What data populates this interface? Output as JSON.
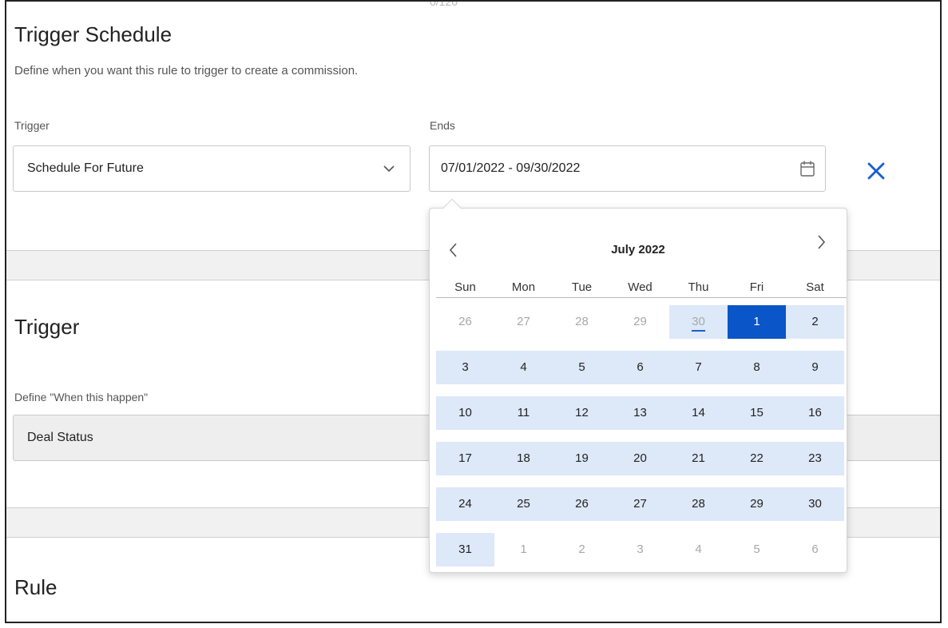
{
  "counter_text": "0/120",
  "trigger_schedule": {
    "title": "Trigger Schedule",
    "description": "Define when you want this rule to trigger to create a commission.",
    "trigger_label": "Trigger",
    "trigger_value": "Schedule For Future",
    "ends_label": "Ends",
    "ends_value": "07/01/2022 - 09/30/2022"
  },
  "trigger_section": {
    "title": "Trigger",
    "define_label": "Define \"When this happen\"",
    "define_value": "Deal Status"
  },
  "rule_section": {
    "title": "Rule"
  },
  "calendar": {
    "month_label": "July 2022",
    "weekdays": [
      "Sun",
      "Mon",
      "Tue",
      "Wed",
      "Thu",
      "Fri",
      "Sat"
    ],
    "weeks": [
      [
        {
          "d": "26",
          "s": "muted"
        },
        {
          "d": "27",
          "s": "muted"
        },
        {
          "d": "28",
          "s": "muted"
        },
        {
          "d": "29",
          "s": "muted"
        },
        {
          "d": "30",
          "s": "muted-range-today"
        },
        {
          "d": "1",
          "s": "selected"
        },
        {
          "d": "2",
          "s": "range"
        }
      ],
      [
        {
          "d": "3",
          "s": "range"
        },
        {
          "d": "4",
          "s": "range"
        },
        {
          "d": "5",
          "s": "range"
        },
        {
          "d": "6",
          "s": "range"
        },
        {
          "d": "7",
          "s": "range"
        },
        {
          "d": "8",
          "s": "range"
        },
        {
          "d": "9",
          "s": "range"
        }
      ],
      [
        {
          "d": "10",
          "s": "range"
        },
        {
          "d": "11",
          "s": "range"
        },
        {
          "d": "12",
          "s": "range"
        },
        {
          "d": "13",
          "s": "range"
        },
        {
          "d": "14",
          "s": "range"
        },
        {
          "d": "15",
          "s": "range"
        },
        {
          "d": "16",
          "s": "range"
        }
      ],
      [
        {
          "d": "17",
          "s": "range"
        },
        {
          "d": "18",
          "s": "range"
        },
        {
          "d": "19",
          "s": "range"
        },
        {
          "d": "20",
          "s": "range"
        },
        {
          "d": "21",
          "s": "range"
        },
        {
          "d": "22",
          "s": "range"
        },
        {
          "d": "23",
          "s": "range"
        }
      ],
      [
        {
          "d": "24",
          "s": "range"
        },
        {
          "d": "25",
          "s": "range"
        },
        {
          "d": "26",
          "s": "range"
        },
        {
          "d": "27",
          "s": "range"
        },
        {
          "d": "28",
          "s": "range"
        },
        {
          "d": "29",
          "s": "range"
        },
        {
          "d": "30",
          "s": "range"
        }
      ],
      [
        {
          "d": "31",
          "s": "range"
        },
        {
          "d": "1",
          "s": "muted"
        },
        {
          "d": "2",
          "s": "muted"
        },
        {
          "d": "3",
          "s": "muted"
        },
        {
          "d": "4",
          "s": "muted"
        },
        {
          "d": "5",
          "s": "muted"
        },
        {
          "d": "6",
          "s": "muted"
        }
      ]
    ]
  },
  "icons": {
    "trigger_dropdown": "chevron-down-icon",
    "ends_picker": "calendar-icon",
    "clear": "close-icon",
    "prev_month": "chevron-left-icon",
    "next_month": "chevron-right-icon"
  },
  "colors": {
    "accent": "#0a55c7",
    "range_highlight": "#dde8f8",
    "close_icon": "#1a5fd0"
  }
}
